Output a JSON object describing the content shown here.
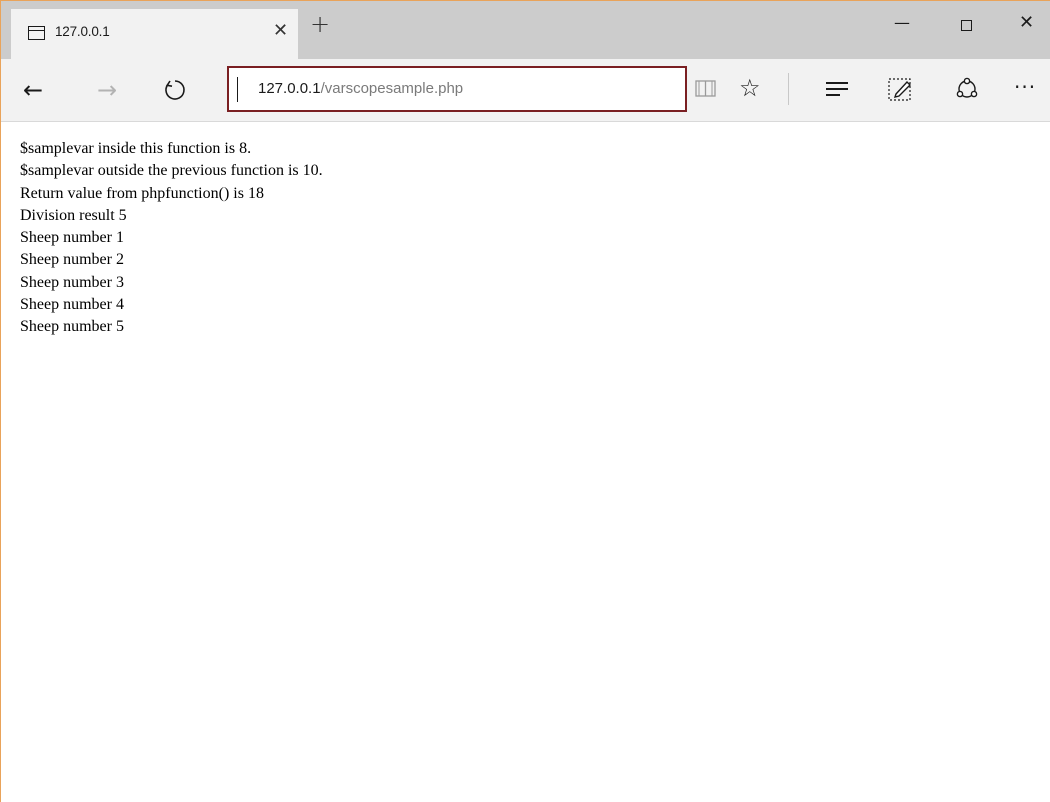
{
  "tab": {
    "title": "127.0.0.1",
    "icon": "tab-page-icon",
    "close_icon": "close-icon"
  },
  "new_tab_icon": "plus-icon",
  "window_controls": {
    "minimize_icon": "minimize-icon",
    "maximize_icon": "maximize-icon",
    "close_icon": "close-icon"
  },
  "toolbar": {
    "back_icon": "arrow-left-icon",
    "forward_icon": "arrow-right-icon",
    "refresh_icon": "refresh-icon",
    "reading_view_icon": "book-icon",
    "favorite_icon": "star-icon",
    "hub_icon": "hub-icon",
    "note_icon": "web-note-icon",
    "share_icon": "share-icon",
    "more_icon": "ellipsis-icon"
  },
  "address": {
    "host": "127.0.0.1",
    "path": "/varscopesample.php",
    "border_color": "#7a1f22"
  },
  "page": {
    "lines": [
      "$samplevar inside this function is 8.",
      "$samplevar outside the previous function is 10.",
      "Return value from phpfunction() is 18",
      "Division result 5",
      "Sheep number 1",
      "Sheep number 2",
      "Sheep number 3",
      "Sheep number 4",
      "Sheep number 5"
    ]
  },
  "colors": {
    "titlebar": "#cccccc",
    "active_tab": "#f2f2f2",
    "window_accent": "#e9a35a"
  }
}
